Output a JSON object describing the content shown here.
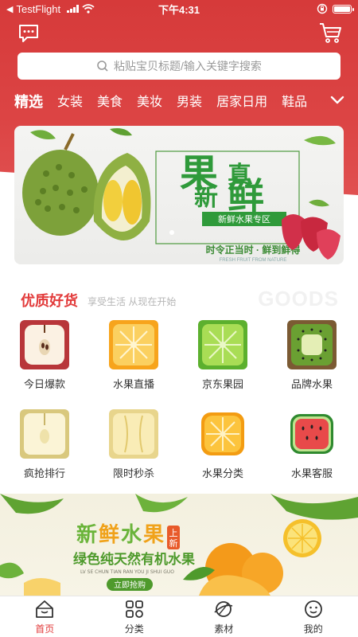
{
  "status_bar": {
    "carrier": "TestFlight",
    "time": "下午4:31"
  },
  "search": {
    "placeholder": "粘贴宝贝标题/输入关键字搜索"
  },
  "categories": [
    "精选",
    "女装",
    "美食",
    "美妆",
    "男装",
    "居家日用",
    "鞋品"
  ],
  "banner": {
    "headline_chars": [
      "果",
      "真",
      "新",
      "鲜"
    ],
    "tag": "新鲜水果专区",
    "slogan": "时令正当时 · 鲜到鲜得",
    "slogan_en": "FRESH FRUIT FROM NATURE"
  },
  "goods_section": {
    "title": "优质好货",
    "subtitle": "享受生活 从现在开始",
    "watermark": "GOODS"
  },
  "grid_items": [
    {
      "label": "今日爆款",
      "icon": "apple-half-icon"
    },
    {
      "label": "水果直播",
      "icon": "orange-slice-icon"
    },
    {
      "label": "京东果园",
      "icon": "lime-slice-icon"
    },
    {
      "label": "品牌水果",
      "icon": "kiwi-icon"
    },
    {
      "label": "疯抢排行",
      "icon": "pear-half-icon"
    },
    {
      "label": "限时秒杀",
      "icon": "banana-icon"
    },
    {
      "label": "水果分类",
      "icon": "orange-cube-icon"
    },
    {
      "label": "水果客服",
      "icon": "watermelon-icon"
    }
  ],
  "banner2": {
    "title_chars": [
      "新",
      "鲜",
      "水",
      "果"
    ],
    "badge_top": "上",
    "badge_bottom": "新",
    "subtitle": "绿色纯天然有机水果",
    "pinyin": "LV SE CHUN TIAN RAN YOU JI SHUI GUO",
    "button": "立即抢购"
  },
  "tabbar": [
    {
      "label": "首页",
      "icon": "home-icon",
      "active": true
    },
    {
      "label": "分类",
      "icon": "category-icon",
      "active": false
    },
    {
      "label": "素材",
      "icon": "planet-icon",
      "active": false
    },
    {
      "label": "我的",
      "icon": "profile-icon",
      "active": false
    }
  ],
  "colors": {
    "brand_red": "#e23b3b",
    "header_red": "#d63a3a",
    "banner_green": "#2f9a3a"
  }
}
